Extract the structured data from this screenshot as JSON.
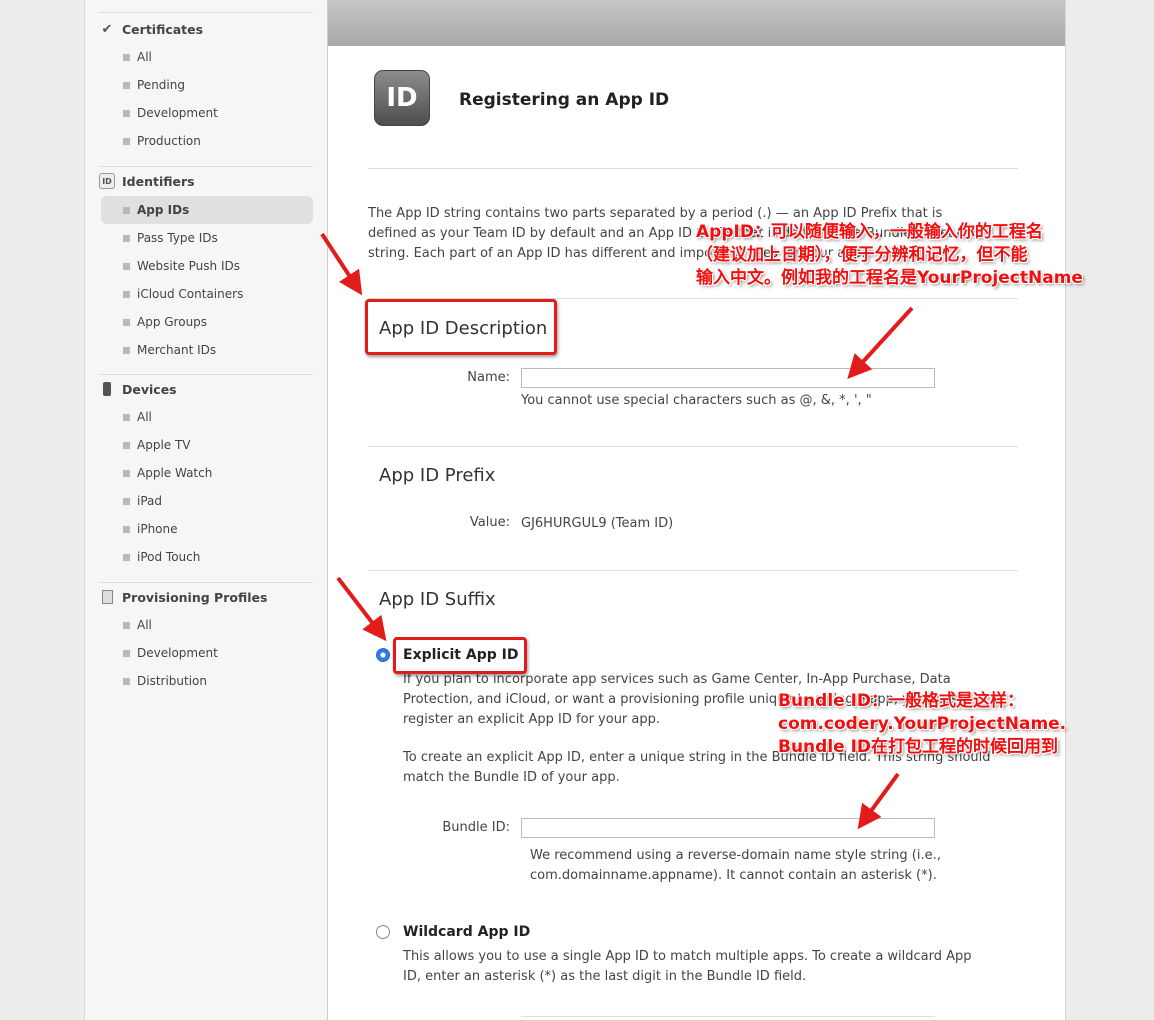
{
  "sidebar": {
    "certificates": {
      "title": "Certificates",
      "items": [
        "All",
        "Pending",
        "Development",
        "Production"
      ]
    },
    "identifiers": {
      "title": "Identifiers",
      "icon_text": "ID",
      "items": [
        "App IDs",
        "Pass Type IDs",
        "Website Push IDs",
        "iCloud Containers",
        "App Groups",
        "Merchant IDs"
      ]
    },
    "devices": {
      "title": "Devices",
      "items": [
        "All",
        "Apple TV",
        "Apple Watch",
        "iPad",
        "iPhone",
        "iPod Touch"
      ]
    },
    "profiles": {
      "title": "Provisioning Profiles",
      "items": [
        "All",
        "Development",
        "Distribution"
      ]
    }
  },
  "main": {
    "icon_text": "ID",
    "title": "Registering an App ID",
    "intro": "The App ID string contains two parts separated by a period (.) — an App ID Prefix that is defined as your Team ID by default and an App ID Suffix that is defined as a Bundle ID search string. Each part of an App ID has different and important uses for your app.",
    "description": {
      "heading": "App ID Description",
      "name_label": "Name:",
      "name_value": "",
      "name_hint": "You cannot use special characters such as @, &, *, ', \""
    },
    "prefix": {
      "heading": "App ID Prefix",
      "value_label": "Value:",
      "value": "GJ6HURGUL9 (Team ID)"
    },
    "suffix": {
      "heading": "App ID Suffix",
      "explicit": {
        "label": "Explicit App ID",
        "selected": true,
        "text1": "If you plan to incorporate app services such as Game Center, In-App Purchase, Data Protection, and iCloud, or want a provisioning profile unique to a single app, you must register an explicit App ID for your app.",
        "text2": "To create an explicit App ID, enter a unique string in the Bundle ID field. This string should match the Bundle ID of your app.",
        "bundle_label": "Bundle ID:",
        "bundle_value": "",
        "bundle_hint": "We recommend using a reverse-domain name style string (i.e., com.domainname.appname). It cannot contain an asterisk (*)."
      },
      "wildcard": {
        "label": "Wildcard App ID",
        "selected": false,
        "text": "This allows you to use a single App ID to match multiple apps. To create a wildcard App ID, enter an asterisk (*) as the last digit in the Bundle ID field."
      }
    }
  },
  "annotations": {
    "appid": [
      "AppID：可以随便输入，一般输入你的工程名",
      "（建议加上日期），便于分辨和记忆，但不能",
      "输入中文。例如我的工程名是YourProjectName"
    ],
    "bundle": [
      "Bundle ID：一般格式是这样：",
      "com.codery.YourProjectName.",
      "Bundle ID在打包工程的时候回用到"
    ],
    "color": "#f01010"
  },
  "colors": {
    "accent": "#2f7de1",
    "highlight": "#e21b1b"
  }
}
